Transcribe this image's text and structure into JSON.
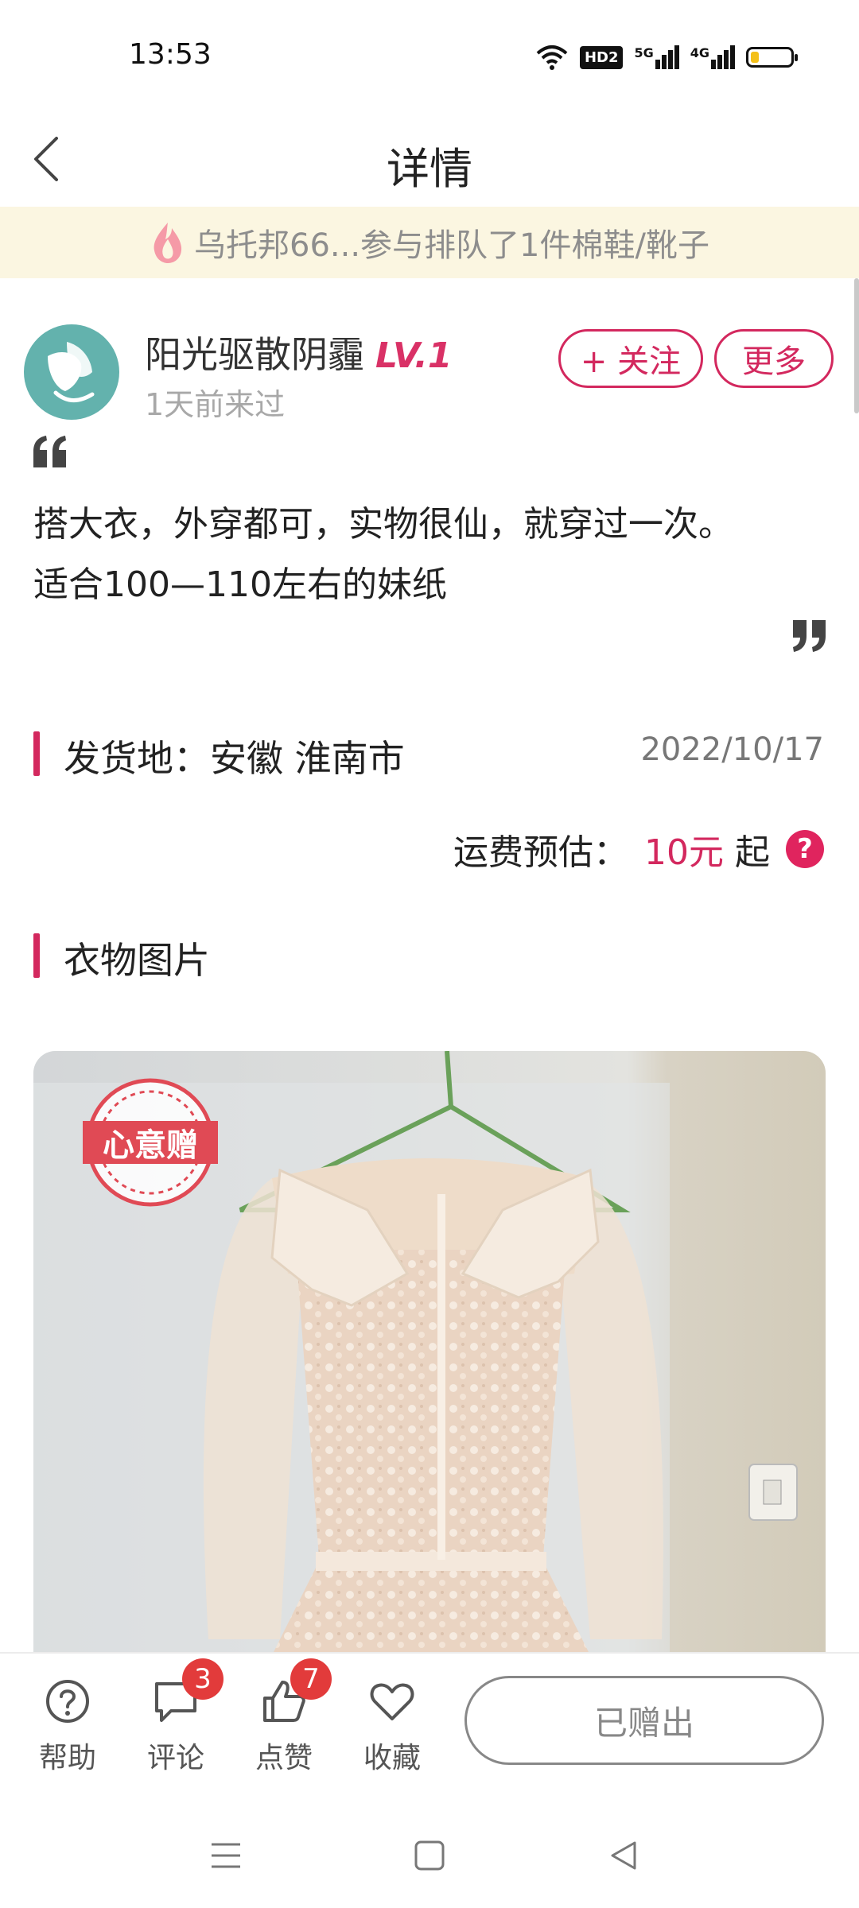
{
  "status_bar": {
    "time": "13:53",
    "hd_label": "HD2",
    "net1": "5G",
    "net2": "4G",
    "battery_level_percent": 20,
    "battery_color": "#f4c019"
  },
  "header": {
    "title": "详情",
    "back_icon": "chevron-left-icon"
  },
  "notice": {
    "text": "乌托邦66...参与排队了1件棉鞋/靴子",
    "icon": "flame-icon"
  },
  "user": {
    "name": "阳光驱散阴霾",
    "level": "LV.1",
    "last_seen": "1天前来过",
    "follow_label": "+ 关注",
    "more_label": "更多"
  },
  "post": {
    "description_lines": [
      "搭大衣，外穿都可，实物很仙，就穿过一次。",
      "适合100—110左右的妹纸"
    ]
  },
  "shipping": {
    "origin_label": "发货地：安徽 淮南市",
    "date": "2022/10/17",
    "fee_label": "运费预估：",
    "fee_amount": "10元",
    "fee_suffix": "起",
    "help_symbol": "?"
  },
  "photos": {
    "title": "衣物图片",
    "stamp_text": "心意赠"
  },
  "bottom_bar": {
    "help_label": "帮助",
    "comment_label": "评论",
    "comment_count": "3",
    "like_label": "点赞",
    "like_count": "7",
    "favorite_label": "收藏",
    "status_button": "已赠出"
  },
  "colors": {
    "accent": "#d3285e",
    "notice_bg": "#fbf6e1",
    "badge": "#e23b3b"
  }
}
